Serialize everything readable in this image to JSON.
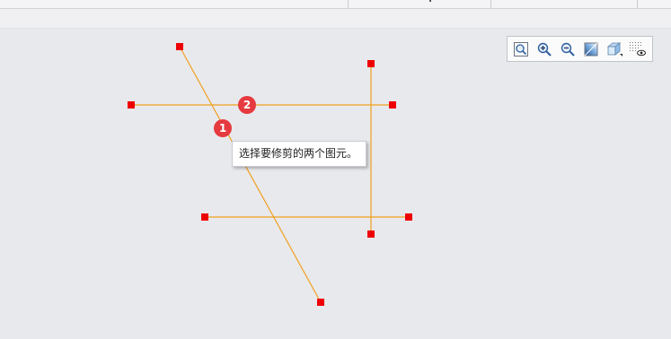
{
  "tooltip": {
    "text": "选择要修剪的两个图元。"
  },
  "steps": [
    {
      "number": "1"
    },
    {
      "number": "2"
    }
  ],
  "view_toolbar": {
    "buttons": [
      {
        "icon": "zoom-fit-icon"
      },
      {
        "icon": "zoom-in-icon"
      },
      {
        "icon": "zoom-out-icon"
      },
      {
        "icon": "shading-icon"
      },
      {
        "icon": "view-cube-icon"
      },
      {
        "icon": "display-settings-icon"
      }
    ]
  },
  "colors": {
    "line": "#f0a020",
    "endpoint": "#ee0000",
    "step_badge": "#e53a3f",
    "background": "#e8e9ec"
  }
}
